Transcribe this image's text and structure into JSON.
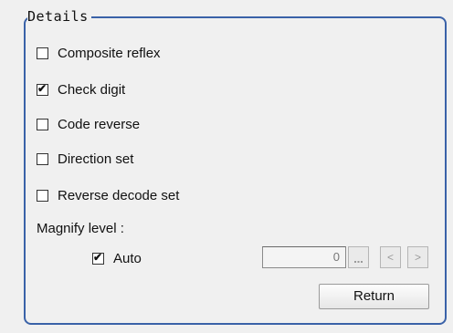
{
  "details": {
    "title": "Details",
    "options": [
      {
        "label": "Composite reflex",
        "checked": false
      },
      {
        "label": "Check digit",
        "checked": true
      },
      {
        "label": "Code reverse",
        "checked": false
      },
      {
        "label": "Direction set",
        "checked": false
      },
      {
        "label": "Reverse decode set",
        "checked": false
      }
    ],
    "magnify_label": "Magnify level :",
    "auto_label": "Auto",
    "auto_checked": true,
    "magnify_value": "0",
    "dropdown_icon": "ellipsis-icon",
    "prev_label": "<",
    "next_label": ">",
    "return_label": "Return"
  },
  "check_mark": "✔"
}
